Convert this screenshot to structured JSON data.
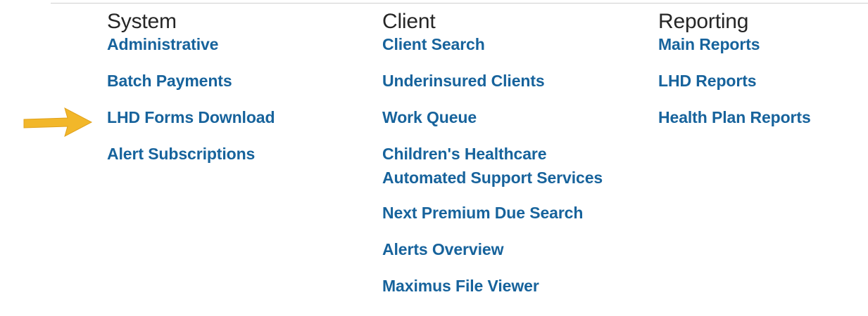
{
  "colors": {
    "heading": "#262626",
    "link": "#17639c",
    "arrow": "#f2b72a",
    "rule": "#cfcfcf"
  },
  "annotation": {
    "icon": "arrow-right-icon",
    "points_to": "LHD Forms Download"
  },
  "columns": [
    {
      "heading": "System",
      "items": [
        {
          "label": "Administrative"
        },
        {
          "label": "Batch Payments"
        },
        {
          "label": "LHD Forms Download"
        },
        {
          "label": "Alert Subscriptions"
        }
      ]
    },
    {
      "heading": "Client",
      "items": [
        {
          "label": "Client Search"
        },
        {
          "label": "Underinsured Clients"
        },
        {
          "label": "Work Queue"
        },
        {
          "label": "Children's Healthcare\nAutomated Support Services"
        },
        {
          "label": "Next Premium Due Search"
        },
        {
          "label": "Alerts Overview"
        },
        {
          "label": "Maximus File Viewer"
        }
      ]
    },
    {
      "heading": "Reporting",
      "items": [
        {
          "label": "Main Reports"
        },
        {
          "label": "LHD Reports"
        },
        {
          "label": "Health Plan Reports"
        }
      ]
    }
  ]
}
